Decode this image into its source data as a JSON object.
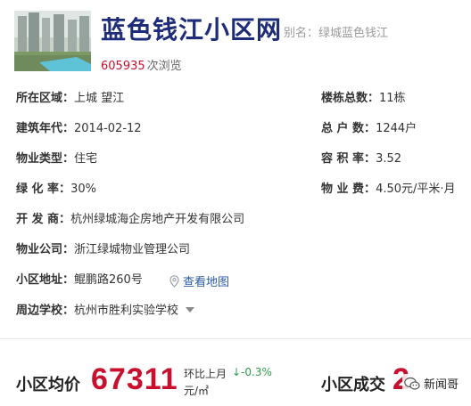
{
  "header": {
    "community_name": "蓝色钱江小区网",
    "alias": "别名：绿城蓝色钱江",
    "view_count": "605935",
    "view_unit": "次浏览",
    "thumbnail_icon": "residential-towers-photo"
  },
  "details": {
    "district": {
      "label": "所在区域：",
      "value": "上城 望江"
    },
    "build_year": {
      "label": "建筑年代：",
      "value": "2014-02-12"
    },
    "property_type": {
      "label": "物业类型：",
      "value": "住宅"
    },
    "green_rate": {
      "label": "绿 化 率：",
      "value": "30%"
    },
    "developer": {
      "label": "开 发 商：",
      "value": "杭州绿城海企房地产开发有限公司"
    },
    "property_company": {
      "label": "物业公司：",
      "value": "浙江绿城物业管理公司"
    },
    "address": {
      "label": "小区地址：",
      "value": "鲲鹏路260号",
      "map_link": "查看地图"
    },
    "nearby_school": {
      "label": "周边学校：",
      "value": "杭州市胜利实验学校"
    },
    "buildings": {
      "label": "楼栋总数：",
      "value": "11栋"
    },
    "households": {
      "label": "总 户 数：",
      "value": "1244户"
    },
    "plot_ratio": {
      "label": "容 积 率：",
      "value": "3.52"
    },
    "property_fee": {
      "label": "物 业 费：",
      "value": "4.50元/平米·月"
    }
  },
  "price": {
    "label": "小区均价",
    "value": "67311",
    "ratio_label": "环比上月",
    "ratio_value": "↓-0.3%",
    "unit": "元/㎡"
  },
  "deals": {
    "label": "小区成交",
    "value": "2"
  },
  "watermark": {
    "text": "新闻哥",
    "icon": "wechat-bubble-icon"
  },
  "colors": {
    "title": "#1e2d7a",
    "accent_red": "#c8102e",
    "link_blue": "#2a5aa8",
    "down_green": "#2e9b4a"
  }
}
